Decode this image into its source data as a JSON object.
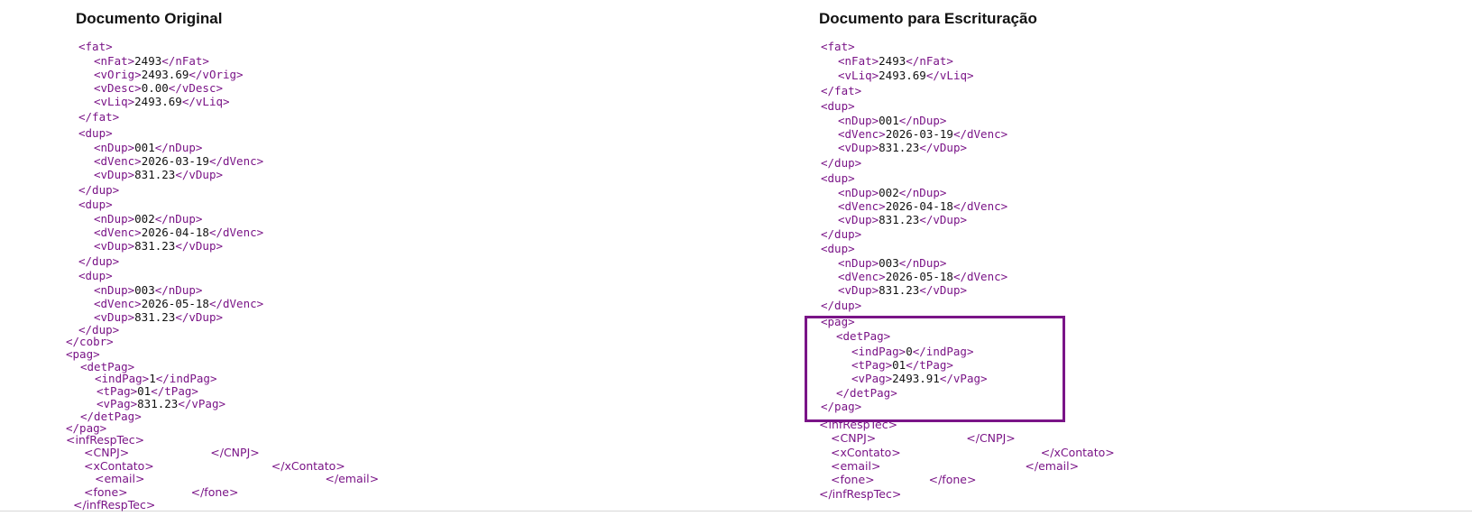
{
  "left": {
    "title": "Documento Original",
    "lines": [
      {
        "pre": "<fat>"
      },
      {
        "pre": "<nFat>",
        "val": "2493",
        "post": "</nFat>"
      },
      {
        "pre": "<vOrig>",
        "val": "2493.69",
        "post": "</vOrig>"
      },
      {
        "pre": "<vDesc>",
        "val": "0.00",
        "post": "</vDesc>"
      },
      {
        "pre": "<vLiq>",
        "val": "2493.69",
        "post": "</vLiq>"
      },
      {
        "pre": "</fat>"
      },
      {
        "pre": "<dup>"
      },
      {
        "pre": "<nDup>",
        "val": "001",
        "post": "</nDup>"
      },
      {
        "pre": "<dVenc>",
        "val": "2026-03-19",
        "post": "</dVenc>"
      },
      {
        "pre": "<vDup>",
        "val": "831.23",
        "post": "</vDup>"
      },
      {
        "pre": "</dup>"
      },
      {
        "pre": "<dup>"
      },
      {
        "pre": "<nDup>",
        "val": "002",
        "post": "</nDup>"
      },
      {
        "pre": "<dVenc>",
        "val": "2026-04-18",
        "post": "</dVenc>"
      },
      {
        "pre": "<vDup>",
        "val": "831.23",
        "post": "</vDup>"
      },
      {
        "pre": "</dup>"
      },
      {
        "pre": "<dup>"
      },
      {
        "pre": "<nDup>",
        "val": "003",
        "post": "</nDup>"
      },
      {
        "pre": "<dVenc>",
        "val": "2026-05-18",
        "post": "</dVenc>"
      },
      {
        "pre": "<vDup>",
        "val": "831.23",
        "post": "</vDup>"
      },
      {
        "pre": "</dup>"
      },
      {
        "pre": "</cobr>"
      },
      {
        "pre": "<pag>"
      },
      {
        "pre": "<detPag>"
      },
      {
        "pre": "<indPag>",
        "val": "1",
        "post": "</indPag>"
      },
      {
        "pre": "<tPag>",
        "val": "01",
        "post": "</tPag>"
      },
      {
        "pre": "<vPag>",
        "val": "831.23",
        "post": "</vPag>"
      },
      {
        "pre": "</detPag>"
      },
      {
        "pre": "</pag>"
      },
      {
        "pre": "<infRespTec>"
      },
      {
        "pre": "<CNPJ>",
        "post": "</CNPJ>"
      },
      {
        "pre": "<xContato>",
        "post": "</xContato>"
      },
      {
        "pre": "<email>",
        "post": "</email>"
      },
      {
        "pre": "<fone>",
        "post": "</fone>"
      },
      {
        "pre": "</infRespTec>"
      }
    ]
  },
  "right": {
    "title": "Documento para Escrituração",
    "lines": [
      {
        "pre": "<fat>"
      },
      {
        "pre": "<nFat>",
        "val": "2493",
        "post": "</nFat>"
      },
      {
        "pre": "<vLiq>",
        "val": "2493.69",
        "post": "</vLiq>"
      },
      {
        "pre": "</fat>"
      },
      {
        "pre": "<dup>"
      },
      {
        "pre": "<nDup>",
        "val": "001",
        "post": "</nDup>"
      },
      {
        "pre": "<dVenc>",
        "val": "2026-03-19",
        "post": "</dVenc>"
      },
      {
        "pre": "<vDup>",
        "val": "831.23",
        "post": "</vDup>"
      },
      {
        "pre": "</dup>"
      },
      {
        "pre": "<dup>"
      },
      {
        "pre": "<nDup>",
        "val": "002",
        "post": "</nDup>"
      },
      {
        "pre": "<dVenc>",
        "val": "2026-04-18",
        "post": "</dVenc>"
      },
      {
        "pre": "<vDup>",
        "val": "831.23",
        "post": "</vDup>"
      },
      {
        "pre": "</dup>"
      },
      {
        "pre": "<dup>"
      },
      {
        "pre": "<nDup>",
        "val": "003",
        "post": "</nDup>"
      },
      {
        "pre": "<dVenc>",
        "val": "2026-05-18",
        "post": "</dVenc>"
      },
      {
        "pre": "<vDup>",
        "val": "831.23",
        "post": "</vDup>"
      },
      {
        "pre": "</dup>"
      },
      {
        "pre": "<pag>"
      },
      {
        "pre": "<detPag>"
      },
      {
        "pre": "<indPag>",
        "val": "0",
        "post": "</indPag>"
      },
      {
        "pre": "<tPag>",
        "val": "01",
        "post": "</tPag>"
      },
      {
        "pre": "<vPag>",
        "val": "2493.91",
        "post": "</vPag>"
      },
      {
        "pre": "</detPag>"
      },
      {
        "pre": "</pag>"
      },
      {
        "pre": "<infRespTec>"
      },
      {
        "pre": "<CNPJ>",
        "post": "</CNPJ>"
      },
      {
        "pre": "<xContato>",
        "post": "</xContato>"
      },
      {
        "pre": "<email>",
        "post": "</email>"
      },
      {
        "pre": "<fone>",
        "post": "</fone>"
      },
      {
        "pre": "</infRespTec>"
      }
    ]
  },
  "colors": {
    "tag": "#7a1487",
    "value": "#111111",
    "highlight": "#7a1487"
  }
}
